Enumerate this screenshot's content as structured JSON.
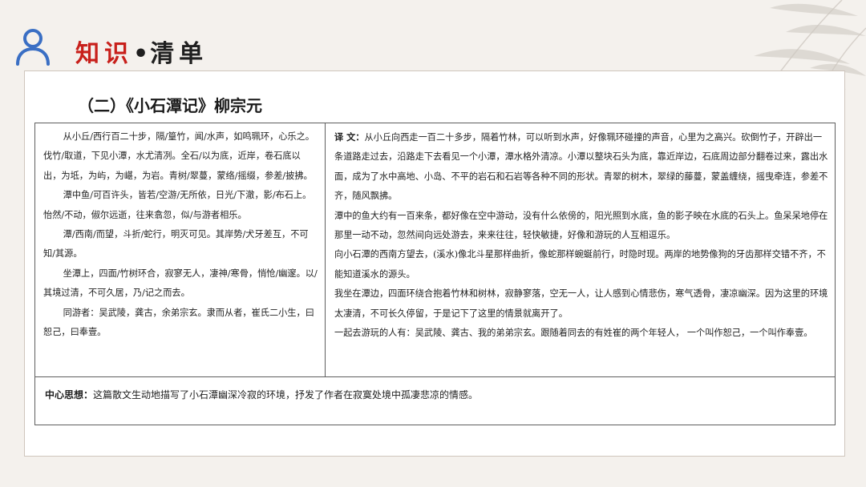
{
  "header": {
    "title_part1": "知识",
    "separator": "•",
    "title_part2": "清单"
  },
  "section": {
    "title": "（二）《小石潭记》柳宗元"
  },
  "original_text": [
    "从小丘/西行百二十步，隔/篁竹，闻/水声，如鸣珮环，心乐之。伐竹/取道，下见小潭，水尤清冽。全石/以为底，近岸，卷石底以出，为坻，为屿，为嵁，为岩。青树/翠蔓，蒙络/摇缀，参差/披拂。",
    "潭中鱼/可百许头，皆若/空游/无所依，日光/下澈，影/布石上。怡然/不动，俶尔远逝，往来翕忽，似/与游者相乐。",
    "潭/西南/而望，斗折/蛇行，明灭可见。其岸势/犬牙差互，不可知/其源。",
    "坐潭上，四面/竹树环合，寂寥无人，凄神/寒骨，悄怆/幽邃。以/其境过清，不可久居，乃/记之而去。",
    "同游者：吴武陵，龚古，余弟宗玄。隶而从者，崔氏二小生，曰恕己，曰奉壹。"
  ],
  "translation": {
    "label": "译 文：",
    "paragraphs": [
      "从小丘向西走一百二十多步，隔着竹林，可以听到水声，好像珮环碰撞的声音，心里为之高兴。砍倒竹子，开辟出一条道路走过去，沿路走下去看见一个小潭，潭水格外清凉。小潭以整块石头为底，靠近岸边，石底周边部分翻卷过来，露出水面，成为了水中高地、小岛、不平的岩石和石岩等各种不同的形状。青翠的树木，翠绿的藤蔓，蒙盖缠绕，摇曳牵连，参差不齐，随风飘拂。",
      "潭中的鱼大约有一百来条，都好像在空中游动，没有什么依傍的，阳光照到水底，鱼的影子映在水底的石头上。鱼呆呆地停在那里一动不动，忽然间向远处游去，来来往往，轻快敏捷，好像和游玩的人互相逗乐。",
      "向小石潭的西南方望去，(溪水)像北斗星那样曲折，像蛇那样蜿蜒前行，时隐时现。两岸的地势像狗的牙齿那样交错不齐，不能知道溪水的源头。",
      "我坐在潭边，四面环绕合抱着竹林和树林，寂静寥落，空无一人，让人感到心情悲伤，寒气透骨，凄凉幽深。因为这里的环境太凄清，不可长久停留，于是记下了这里的情景就离开了。",
      "一起去游玩的人有：吴武陵、龚古、我的弟弟宗玄。跟随着同去的有姓崔的两个年轻人， 一个叫作恕己，一个叫作奉壹。"
    ]
  },
  "summary": {
    "label": "中心思想：",
    "text": "这篇散文生动地描写了小石潭幽深冷寂的环境，抒发了作者在寂寞处境中孤凄悲凉的情感。"
  },
  "colors": {
    "accent_red": "#c8201b",
    "icon_blue": "#3a6fc4",
    "background": "#f4f1ed"
  }
}
